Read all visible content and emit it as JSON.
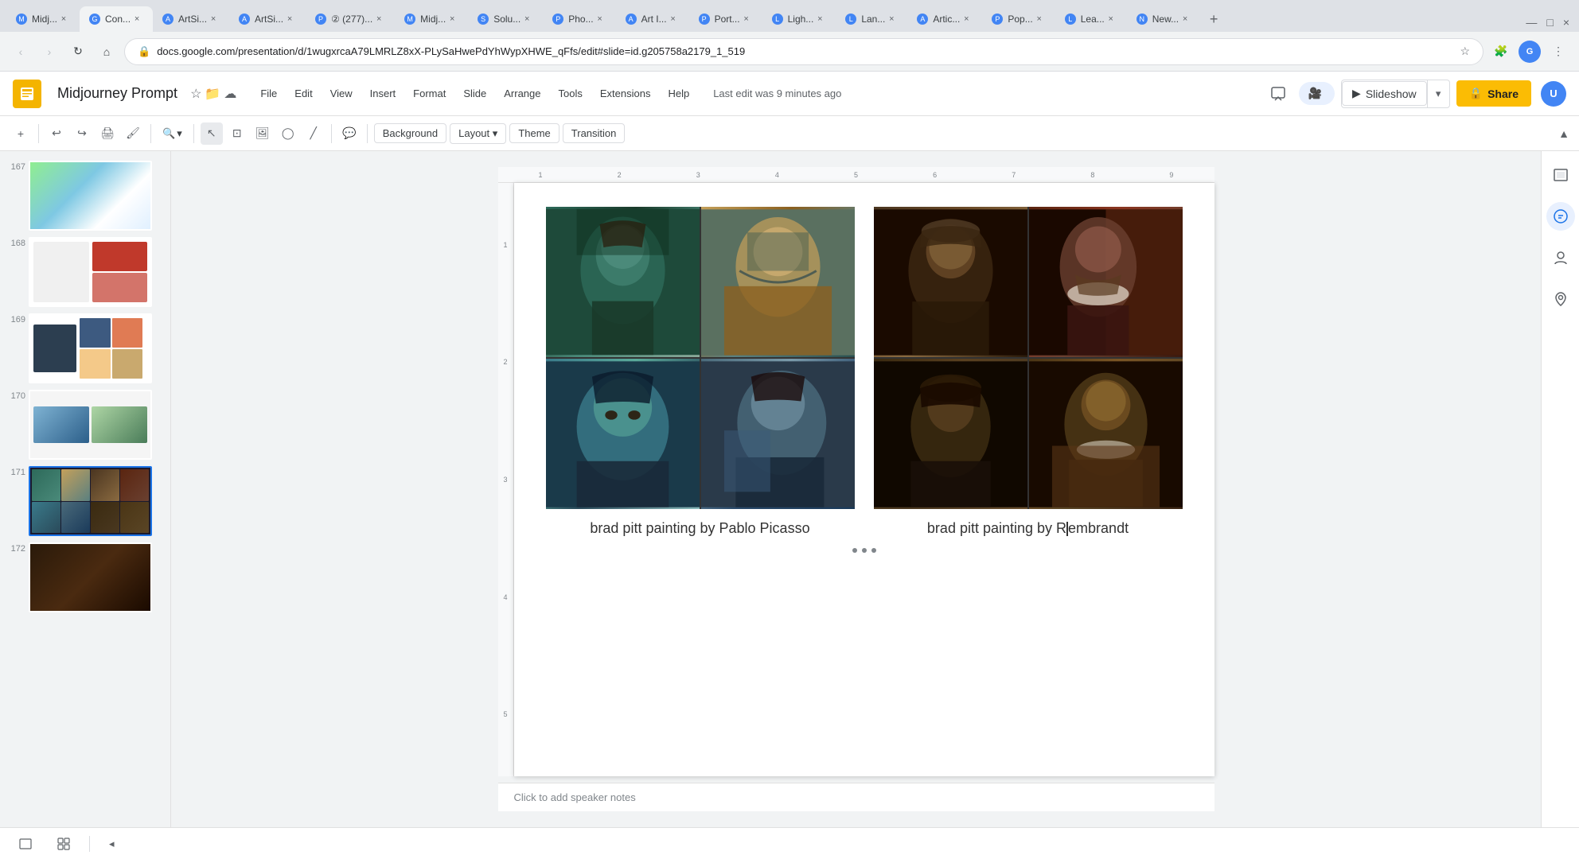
{
  "browser": {
    "tabs": [
      {
        "id": "midjourney1",
        "label": "Midj...",
        "favicon": "yellow",
        "active": false
      },
      {
        "id": "concepts",
        "label": "Con...",
        "favicon": "blue",
        "active": true
      },
      {
        "id": "artsi1",
        "label": "ArtSi...",
        "favicon": "green",
        "active": false
      },
      {
        "id": "artsi2",
        "label": "ArtSi...",
        "favicon": "green",
        "active": false
      },
      {
        "id": "pinterest",
        "label": "② (277)...",
        "favicon": "red",
        "active": false
      },
      {
        "id": "midjourney2",
        "label": "Midj...",
        "favicon": "yellow",
        "active": false
      },
      {
        "id": "solutions",
        "label": "Solu...",
        "favicon": "blue",
        "active": false
      },
      {
        "id": "photos",
        "label": "Pho...",
        "favicon": "blue",
        "active": false
      },
      {
        "id": "arti3",
        "label": "Art I...",
        "favicon": "blue",
        "active": false
      },
      {
        "id": "portfolio",
        "label": "Port...",
        "favicon": "blue",
        "active": false
      },
      {
        "id": "light",
        "label": "Ligh...",
        "favicon": "blue",
        "active": false
      },
      {
        "id": "land",
        "label": "Lan...",
        "favicon": "blue",
        "active": false
      },
      {
        "id": "article",
        "label": "Artic...",
        "favicon": "blue",
        "active": false
      },
      {
        "id": "popular",
        "label": "Pop...",
        "favicon": "red",
        "active": false
      },
      {
        "id": "leads",
        "label": "Lea...",
        "favicon": "green",
        "active": false
      },
      {
        "id": "new",
        "label": "New...",
        "favicon": "blue",
        "active": false
      }
    ],
    "url": "docs.google.com/presentation/d/1wugxrcaA79LMRLZ8xX-PLySaHwePdYhWypXHWE_qFfs/edit#slide=id.g205758a2179_1_519",
    "nav": {
      "back": "‹",
      "forward": "›",
      "refresh": "↻",
      "home": "⌂"
    }
  },
  "app": {
    "logo": "G",
    "title": "Midjourney Prompt",
    "last_edit": "Last edit was 9 minutes ago",
    "menu": [
      "File",
      "Edit",
      "View",
      "Insert",
      "Format",
      "Slide",
      "Arrange",
      "Tools",
      "Extensions",
      "Help"
    ],
    "toolbar": {
      "background_btn": "Background",
      "layout_btn": "Layout",
      "theme_btn": "Theme",
      "transition_btn": "Transition"
    },
    "header_actions": {
      "slideshow": "Slideshow",
      "share": "Share"
    }
  },
  "slides": {
    "items": [
      {
        "num": "167",
        "style": "thumb-167"
      },
      {
        "num": "168",
        "style": "thumb-168"
      },
      {
        "num": "169",
        "style": "thumb-169"
      },
      {
        "num": "170",
        "style": "thumb-170"
      },
      {
        "num": "171",
        "style": "thumb-171",
        "active": true
      },
      {
        "num": "172",
        "style": "thumb-172"
      }
    ],
    "current": {
      "left_caption": "brad pitt painting by Pablo Picasso",
      "right_caption": "brad pitt painting by Rembrandt"
    }
  },
  "notes": {
    "placeholder": "Click to add speaker notes"
  },
  "icons": {
    "comments": "💬",
    "meet": "🎥",
    "slideshow": "▶",
    "share": "🔒",
    "star": "☆",
    "search": "🔍",
    "menu": "⋮",
    "layers": "⊡",
    "palette": "🎨",
    "person": "👤",
    "location": "📍"
  }
}
